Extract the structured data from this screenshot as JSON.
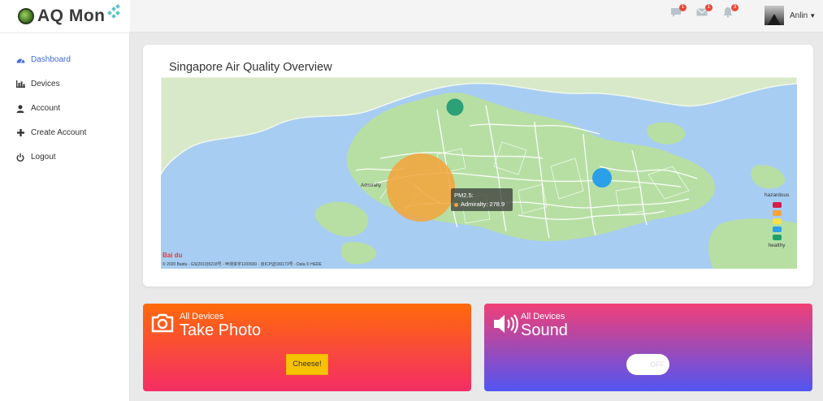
{
  "app": {
    "brand": "AQ Mon"
  },
  "header": {
    "notifications": [
      {
        "name": "chat-icon",
        "count": "1"
      },
      {
        "name": "mail-icon",
        "count": "1"
      },
      {
        "name": "bell-icon",
        "count": "3"
      }
    ],
    "user_name": "Anlin"
  },
  "sidebar": {
    "items": [
      {
        "label": "Dashboard",
        "icon": "speedometer-icon",
        "active": true
      },
      {
        "label": "Devices",
        "icon": "bar-chart-icon",
        "active": false
      },
      {
        "label": "Account",
        "icon": "user-icon",
        "active": false
      },
      {
        "label": "Create Account",
        "icon": "plus-icon",
        "active": false
      },
      {
        "label": "Logout",
        "icon": "power-icon",
        "active": false
      }
    ]
  },
  "map": {
    "title": "Singapore Air Quality Overview",
    "place_label": "Admiralty",
    "tooltip": {
      "heading": "PM2.5:",
      "entry": "Admiralty: 278.9"
    },
    "legend": {
      "top": "hazardous",
      "bottom": "healthy",
      "colors": [
        "#d81b4b",
        "#f5a33b",
        "#f6e04b",
        "#2b9fe8",
        "#22a06b"
      ]
    },
    "logo_text": "Bai du",
    "attribution": "© 2020 Baidu - GS(2019)5218号 - 甲测资字1100930 - 京ICP证030173号 - Data © HERE",
    "sensor_colors": {
      "north": "#2ca076",
      "admiralty": "#f5a33b",
      "east": "#2b9fe8"
    }
  },
  "cards": {
    "photo": {
      "subtitle": "All Devices",
      "title": "Take Photo",
      "button": "Cheese!"
    },
    "sound": {
      "subtitle": "All Devices",
      "title": "Sound",
      "toggle": "OFF"
    }
  }
}
